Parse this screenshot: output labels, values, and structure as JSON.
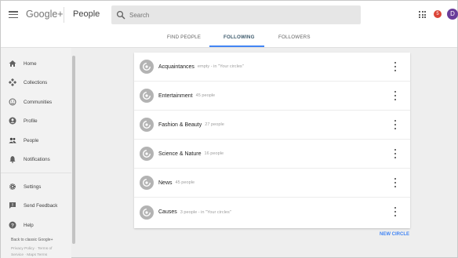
{
  "header": {
    "logo": "Google+",
    "title": "People",
    "search_placeholder": "Search",
    "notification_count": "5",
    "avatar_initial": "D"
  },
  "tabs": [
    {
      "label": "FIND PEOPLE",
      "active": false
    },
    {
      "label": "FOLLOWING",
      "active": true
    },
    {
      "label": "FOLLOWERS",
      "active": false
    }
  ],
  "sidebar": {
    "items": [
      {
        "label": "Home",
        "icon": "home-icon"
      },
      {
        "label": "Collections",
        "icon": "collections-icon"
      },
      {
        "label": "Communities",
        "icon": "communities-icon"
      },
      {
        "label": "Profile",
        "icon": "profile-icon"
      },
      {
        "label": "People",
        "icon": "people-icon"
      },
      {
        "label": "Notifications",
        "icon": "bell-icon"
      },
      {
        "label": "Settings",
        "icon": "gear-icon"
      },
      {
        "label": "Send Feedback",
        "icon": "feedback-icon"
      },
      {
        "label": "Help",
        "icon": "help-icon"
      }
    ],
    "back_to_classic": "Back to classic Google+",
    "footer_links": "Privacy Policy · Terms of Service · Maps Terms"
  },
  "circles": [
    {
      "name": "Acquaintances",
      "meta": "empty - in \"Your circles\""
    },
    {
      "name": "Entertainment",
      "meta": "45 people"
    },
    {
      "name": "Fashion & Beauty",
      "meta": "27 people"
    },
    {
      "name": "Science & Nature",
      "meta": "16 people"
    },
    {
      "name": "News",
      "meta": "45 people"
    },
    {
      "name": "Causes",
      "meta": "3 people - in \"Your circles\""
    }
  ],
  "new_circle_label": "NEW CIRCLE",
  "colors": {
    "accent": "#4285f4",
    "badge": "#db4437",
    "avatar": "#6a3d9a"
  }
}
